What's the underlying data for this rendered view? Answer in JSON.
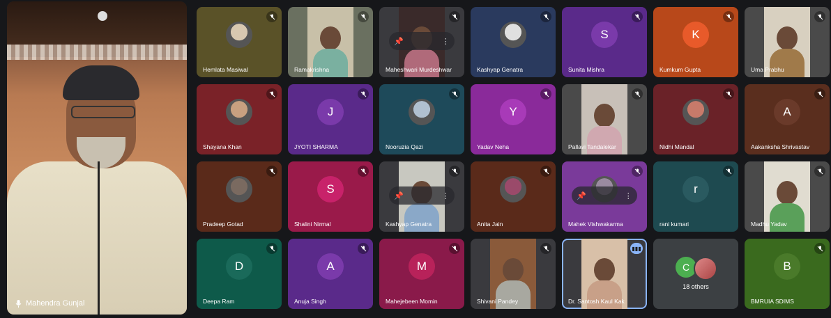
{
  "presenter": {
    "name": "Mahendra Gunjal",
    "mic_icon": "mic-icon"
  },
  "tiles": [
    {
      "name": "Hemlata Masiwal",
      "bg": "#5a5228",
      "kind": "photo",
      "av": "#d8c8b0"
    },
    {
      "name": "Ramakrishna",
      "bg": "#6a7060",
      "kind": "video",
      "body": "#7ab0a0",
      "video_bg": "#c8c0a8"
    },
    {
      "name": "Maheshwari Murdeshwar",
      "bg": "#3a3a3e",
      "kind": "video-pin",
      "body": "#b06a7a",
      "video_bg": "#3a2a2a"
    },
    {
      "name": "Kashyap Genatra",
      "bg": "#2a3a5e",
      "kind": "photo",
      "av": "#e0e0e0"
    },
    {
      "name": "Sunita Mishra",
      "bg": "#5a2a8a",
      "kind": "letter",
      "letter": "S",
      "av": "#7a3aaa"
    },
    {
      "name": "Kumkum Gupta",
      "bg": "#b8481a",
      "kind": "letter",
      "letter": "K",
      "av": "#e85a2a"
    },
    {
      "name": "Uma Prabhu",
      "bg": "#4a4a4a",
      "kind": "video",
      "body": "#a07a4a",
      "video_bg": "#d8d0c0"
    },
    {
      "name": "Shayana Khan",
      "bg": "#7a2228",
      "kind": "photo",
      "av": "#c8a080"
    },
    {
      "name": "JYOTI SHARMA",
      "bg": "#5a2a8a",
      "kind": "letter",
      "letter": "J",
      "av": "#7a3aaa"
    },
    {
      "name": "Nooruzia Qazi",
      "bg": "#1e4a5a",
      "kind": "photo",
      "av": "#b0c0d0"
    },
    {
      "name": "Yadav Neha",
      "bg": "#8a2a9a",
      "kind": "letter",
      "letter": "Y",
      "av": "#a83ab8"
    },
    {
      "name": "Pallavi Tandalekar",
      "bg": "#4a4a4a",
      "kind": "video",
      "body": "#d0a8b0",
      "video_bg": "#c8c0b8"
    },
    {
      "name": "Nidhi Mandal",
      "bg": "#6a2228",
      "kind": "photo",
      "av": "#c87a6a"
    },
    {
      "name": "Aakanksha Shrivastav",
      "bg": "#5a2e1e",
      "kind": "letter",
      "letter": "A",
      "av": "#6a3a2a"
    },
    {
      "name": "Pradeep Gotad",
      "bg": "#5a2a1a",
      "kind": "photo",
      "av": "#7a6a60"
    },
    {
      "name": "Shalini Nirmal",
      "bg": "#9a1a4a",
      "kind": "letter",
      "letter": "S",
      "av": "#c8226a"
    },
    {
      "name": "Kashyap Genatra",
      "bg": "#3a3a3e",
      "kind": "video-pin",
      "body": "#8aa8c8",
      "video_bg": "#c8c8c0"
    },
    {
      "name": "Anita Jain",
      "bg": "#5a2a1a",
      "kind": "photo",
      "av": "#9a4a6a"
    },
    {
      "name": "Mahek Vishwakarma",
      "bg": "#7a3a9a",
      "kind": "photo-pin",
      "av": "#9a8aa0"
    },
    {
      "name": "rani kumari",
      "bg": "#1e4a50",
      "kind": "letter",
      "letter": "r",
      "av": "#2a5a60"
    },
    {
      "name": "Madhu Yadav",
      "bg": "#4a4a4a",
      "kind": "video",
      "body": "#5aa05a",
      "video_bg": "#e0dcd0"
    },
    {
      "name": "Deepa Ram",
      "bg": "#0e5a4a",
      "kind": "letter",
      "letter": "D",
      "av": "#1a6a5a"
    },
    {
      "name": "Anuja Singh",
      "bg": "#5a2a8a",
      "kind": "letter",
      "letter": "A",
      "av": "#7a3aaa"
    },
    {
      "name": "Mahejebeen Momin",
      "bg": "#8a1a4a",
      "kind": "letter",
      "letter": "M",
      "av": "#b8225a"
    },
    {
      "name": "Shivani Pandey",
      "bg": "#3a3a3e",
      "kind": "video",
      "body": "#a8a8a0",
      "video_bg": "#8a5a3a"
    },
    {
      "name": "Dr. Santosh Kaul Kak",
      "bg": "#3a3a3e",
      "kind": "video-speaking",
      "body": "#c8a088",
      "video_bg": "#d8c0a8"
    },
    {
      "name": "",
      "bg": "#3c4043",
      "kind": "others",
      "count": "18 others",
      "letter": "C"
    },
    {
      "name": "BMRUIA SDIMS",
      "bg": "#3a6a1e",
      "kind": "letter",
      "letter": "B",
      "av": "#4a7a2a"
    }
  ],
  "icons": {
    "muted": "mic-off-icon",
    "pin": "pin-icon",
    "more": "more-vert-icon",
    "speaking": "audio-bars-icon"
  }
}
